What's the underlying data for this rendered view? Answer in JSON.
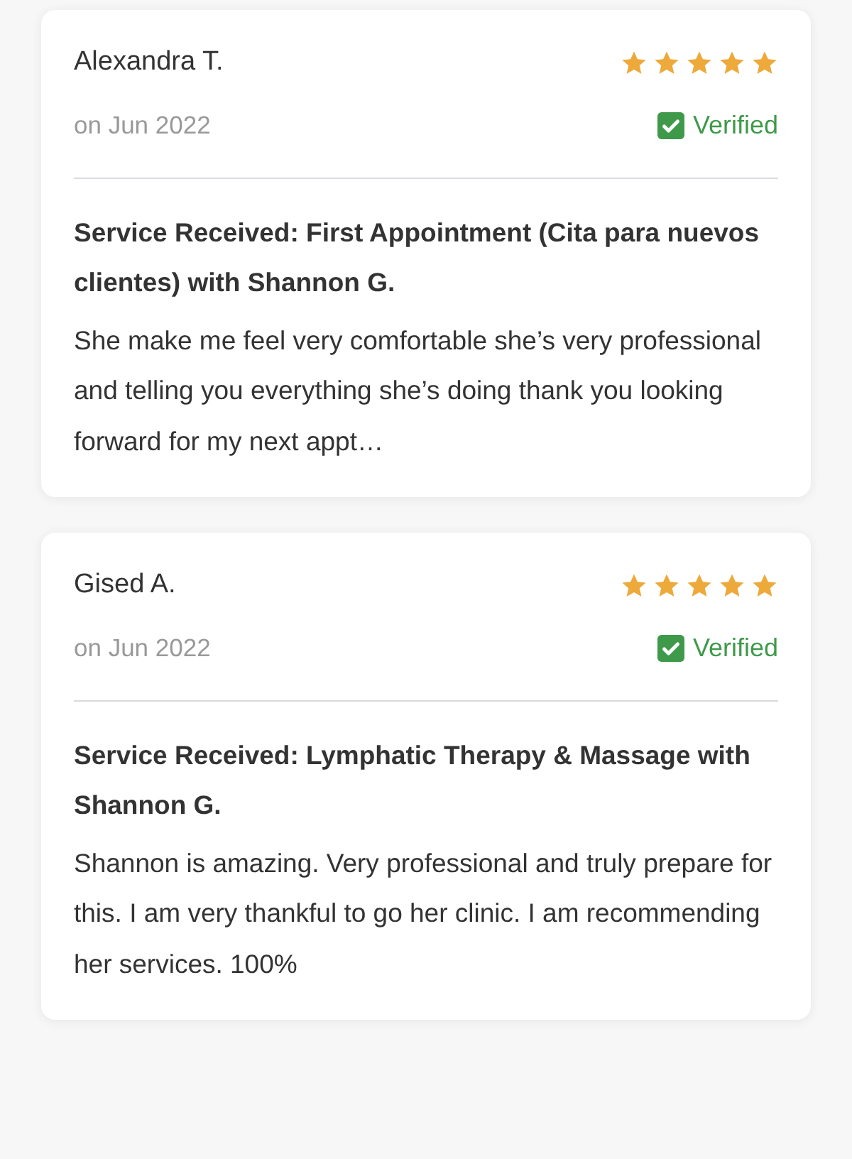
{
  "reviews": [
    {
      "name": "Alexandra T.",
      "stars": 5,
      "date": "on Jun 2022",
      "verified": true,
      "verified_label": "Verified",
      "service": "Service Received: First Appointment (Cita para nuevos clientes) with Shannon G.",
      "text": "She make me feel very comfortable she’s very professional and telling you everything she’s doing thank you looking forward for my next appt…"
    },
    {
      "name": "Gised A.",
      "stars": 5,
      "date": "on Jun 2022",
      "verified": true,
      "verified_label": "Verified",
      "service": "Service Received: Lymphatic Therapy & Massage with Shannon G.",
      "text": "Shannon is amazing. Very professional and truly prepare for this. I am very thankful to go her clinic. I am recommending her services. 100%"
    }
  ]
}
